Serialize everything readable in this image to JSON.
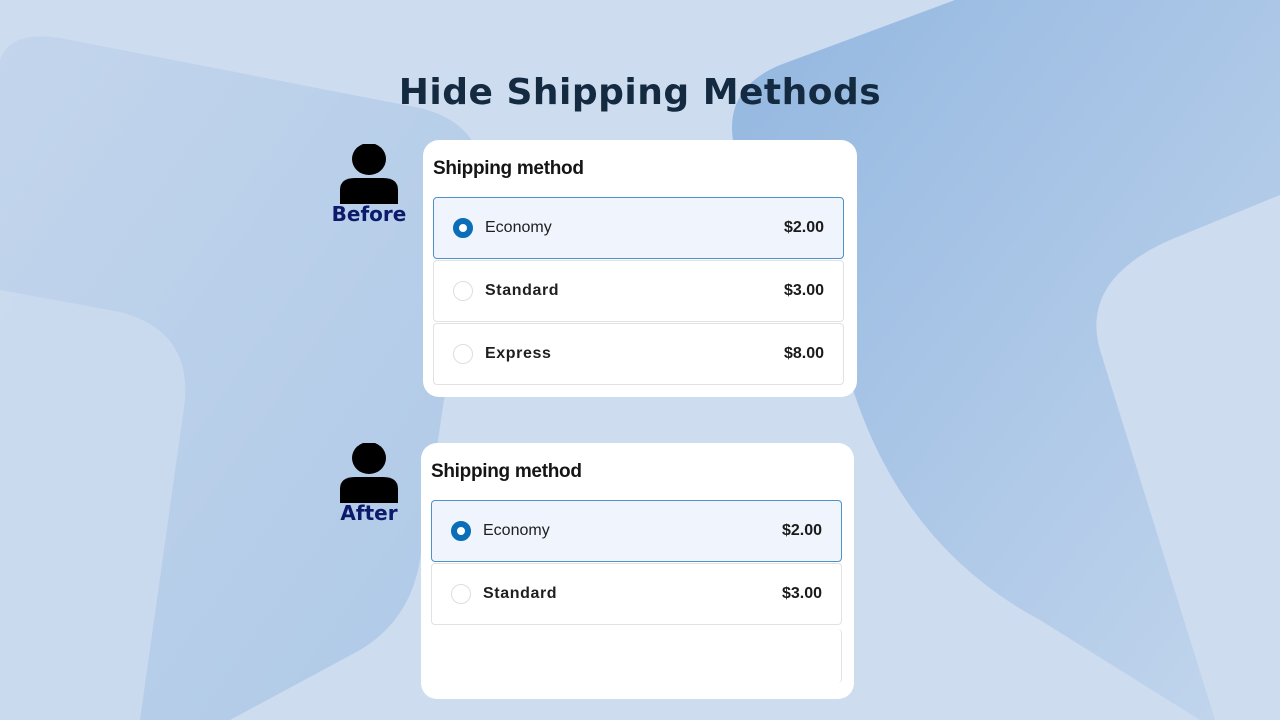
{
  "page": {
    "title": "Hide Shipping Methods"
  },
  "colors": {
    "background": "#cddcef",
    "title_text": "#142a40",
    "persona_label": "#0d1a6b",
    "accent_radio": "#0a6fb8",
    "selected_border": "#4d93c8",
    "selected_bg": "#eff4fd"
  },
  "before": {
    "persona_label": "Before",
    "persona_icon": "user-icon",
    "card_title": "Shipping method",
    "options": [
      {
        "label": "Economy",
        "price": "$2.00",
        "selected": true
      },
      {
        "label": "Standard",
        "price": "$3.00",
        "selected": false
      },
      {
        "label": "Express",
        "price": "$8.00",
        "selected": false
      }
    ]
  },
  "after": {
    "persona_label": "After",
    "persona_icon": "user-icon",
    "card_title": "Shipping method",
    "options": [
      {
        "label": "Economy",
        "price": "$2.00",
        "selected": true
      },
      {
        "label": "Standard",
        "price": "$3.00",
        "selected": false
      }
    ]
  }
}
